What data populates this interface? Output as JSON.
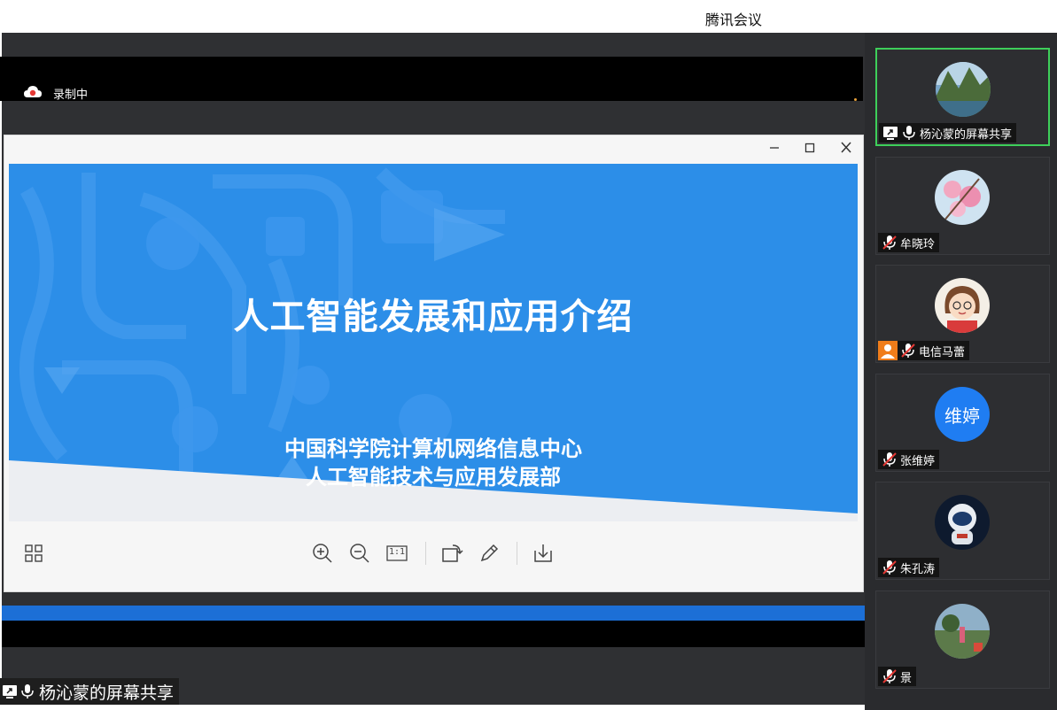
{
  "app": {
    "title": "腾讯会议"
  },
  "recording": {
    "label": "录制中"
  },
  "slide": {
    "title": "人工智能发展和应用介绍",
    "org_line1": "中国科学院计算机网络信息中心",
    "org_line2": "人工智能技术与应用发展部"
  },
  "viewer_window": {
    "buttons": [
      "minimize-icon",
      "maximize-icon",
      "close-icon"
    ]
  },
  "toolbar": {
    "icons": [
      "grid-icon",
      "zoom-in-icon",
      "zoom-out-icon",
      "actual-size-icon",
      "rotate-icon",
      "pen-icon",
      "download-icon"
    ],
    "actual_size_label": "1:1"
  },
  "share": {
    "sharer_label": "杨沁蒙的屏幕共享"
  },
  "participants": [
    {
      "name": "杨沁蒙的屏幕共享",
      "mic": "on",
      "sharing": true,
      "active": true,
      "avatar": "landscape"
    },
    {
      "name": "牟晓玲",
      "mic": "muted",
      "avatar": "blossom"
    },
    {
      "name": "电信马蕾",
      "mic": "muted",
      "avatar": "cartoon-girl",
      "host_badge": true
    },
    {
      "name": "张维婷",
      "mic": "muted",
      "avatar_text": "维婷",
      "avatar_color": "#1f7df2"
    },
    {
      "name": "朱孔涛",
      "mic": "muted",
      "avatar": "astronaut"
    },
    {
      "name": "景",
      "mic": "muted",
      "avatar": "outdoor-photo"
    }
  ],
  "colors": {
    "slide_blue": "#2c8ee8",
    "active_border": "#3ecf5a",
    "host_badge": "#f07d1a",
    "record_dot": "#e8a23a"
  }
}
